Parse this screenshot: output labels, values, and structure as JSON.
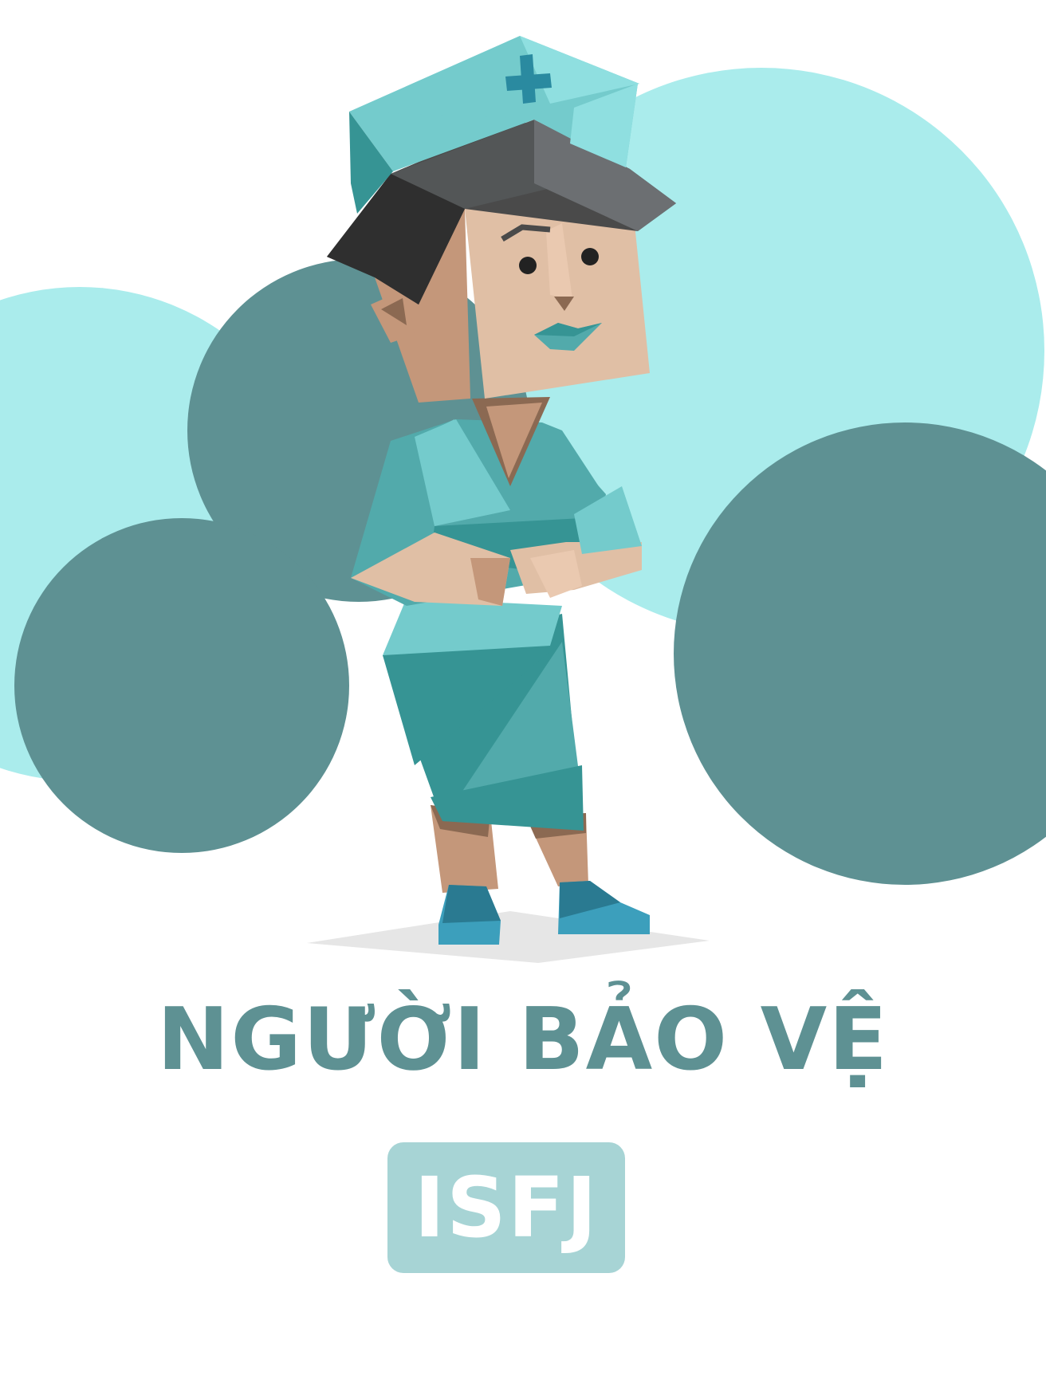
{
  "colors": {
    "background": "#ffffff",
    "light_circle": "#aaecec",
    "dark_circle": "#5e9193",
    "title": "#5e9193",
    "badge_bg": "#a7d4d5",
    "badge_text": "#ffffff"
  },
  "illustration": {
    "subject": "nurse-character"
  },
  "title": "NGƯỜI BẢO VỆ",
  "badge": {
    "label": "ISFJ"
  }
}
